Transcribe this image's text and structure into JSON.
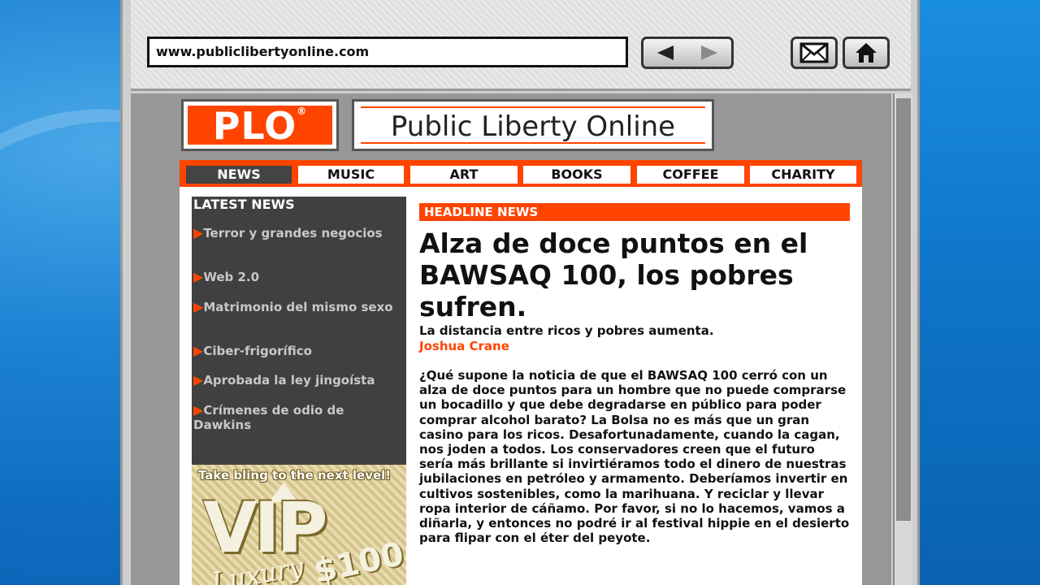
{
  "browser": {
    "url": "www.publiclibertyonline.com"
  },
  "site": {
    "logo_text": "PLO",
    "logo_reg": "®",
    "name": "Public Liberty Online"
  },
  "nav": [
    {
      "label": "NEWS",
      "active": true
    },
    {
      "label": "MUSIC",
      "active": false
    },
    {
      "label": "ART",
      "active": false
    },
    {
      "label": "BOOKS",
      "active": false
    },
    {
      "label": "COFFEE",
      "active": false
    },
    {
      "label": "CHARITY",
      "active": false
    }
  ],
  "sidebar": {
    "title": "LATEST NEWS",
    "items": [
      {
        "label": "Terror y grandes negocios"
      },
      {
        "label": "Web 2.0"
      },
      {
        "label": "Matrimonio del mismo sexo"
      },
      {
        "label": "Ciber-frigorífico"
      },
      {
        "label": "Aprobada la ley jingoísta"
      },
      {
        "label": "Crímenes de odio de Dawkins"
      }
    ]
  },
  "ad": {
    "tagline": "Take bling to the next level!",
    "big": "VIP",
    "script": "Luxury",
    "price": "$100"
  },
  "article": {
    "tag": "HEADLINE NEWS",
    "headline": "Alza de doce puntos en el BAWSAQ 100, los pobres sufren.",
    "subhead": "La distancia entre ricos y pobres aumenta.",
    "author": "Joshua Crane",
    "body": "¿Qué supone la noticia de que el BAWSAQ 100 cerró con un alza de doce puntos para un hombre que no puede comprarse un bocadillo y que debe degradarse en público para poder comprar alcohol barato? La Bolsa no es más que un gran casino para los ricos. Desafortunadamente, cuando la cagan, nos joden a todos. Los conservadores creen que el futuro sería más brillante si invirtiéramos todo el dinero de nuestras jubilaciones en petróleo y armamento. Deberíamos invertir en cultivos sostenibles, como la marihuana. Y reciclar y llevar ropa interior de cáñamo. Por favor, si no lo hacemos, vamos a diñarla, y entonces no podré ir al festival hippie en el desierto para flipar con el éter del peyote."
  },
  "colors": {
    "accent": "#ff4400",
    "sidebar_bg": "#404040",
    "nav_active_bg": "#444444"
  },
  "icons": {
    "back": "back-arrow-icon",
    "forward": "forward-arrow-icon",
    "mail": "mail-icon",
    "home": "home-icon",
    "bullet": "right-triangle-icon"
  }
}
